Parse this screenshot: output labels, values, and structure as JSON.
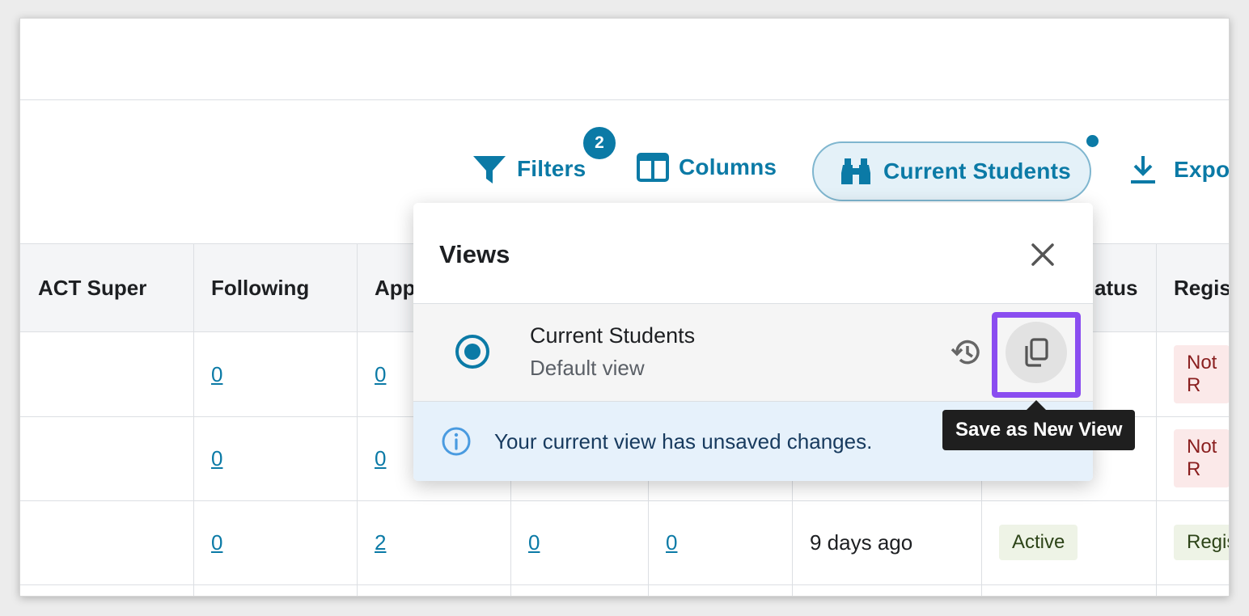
{
  "toolbar": {
    "filters_label": "Filters",
    "filters_badge": "2",
    "columns_label": "Columns",
    "current_view_label": "Current Students",
    "export_label": "Expor"
  },
  "table": {
    "headers": [
      "ACT Super",
      "Following",
      "App",
      "atus",
      "Regis"
    ],
    "rows": [
      {
        "following": "0",
        "app": "0",
        "reg": "Not R"
      },
      {
        "following": "0",
        "app": "0",
        "reg": "Not R"
      },
      {
        "following": "0",
        "app": "2",
        "c3": "0",
        "c4": "0",
        "last": "9 days ago",
        "status": "Active",
        "reg": "Regis"
      }
    ]
  },
  "views_popover": {
    "title": "Views",
    "view_name": "Current Students",
    "view_sub": "Default view",
    "notice": "Your current view has unsaved changes."
  },
  "tooltip": "Save as New View",
  "colors": {
    "accent": "#0b7aa6",
    "focus": "#8a4df0"
  }
}
